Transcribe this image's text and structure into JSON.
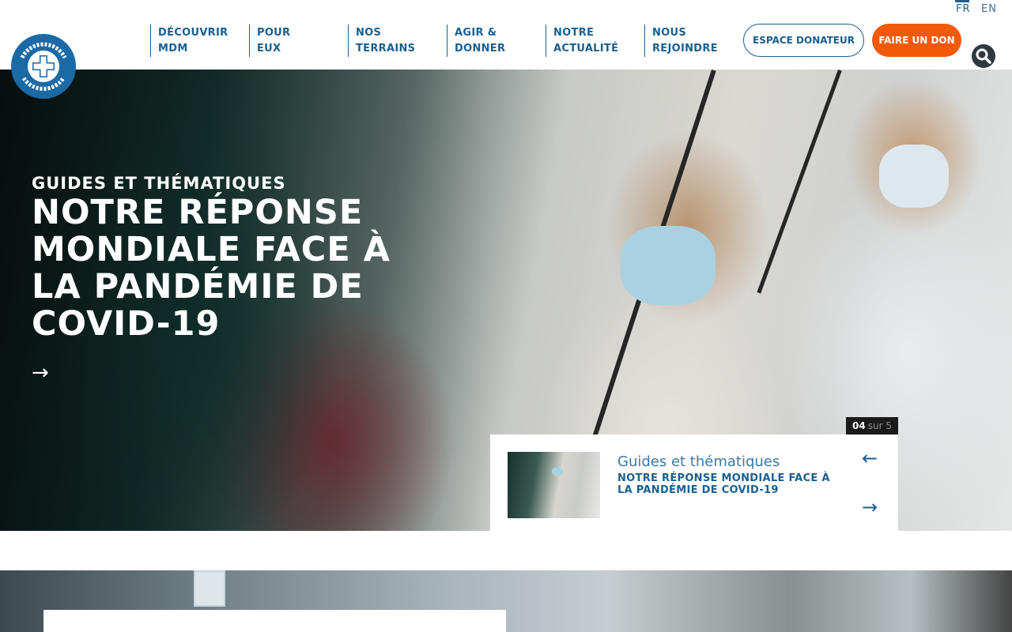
{
  "header": {
    "logo_alt": "MÉDECINS DU MONDE",
    "lang": {
      "fr": "FR",
      "en": "EN"
    },
    "nav": [
      {
        "line1": "DÉCOUVRIR",
        "line2": "MDM"
      },
      {
        "line1": "POUR",
        "line2": "EUX"
      },
      {
        "line1": "NOS",
        "line2": "TERRAINS"
      },
      {
        "line1": "AGIR &",
        "line2": "DONNER"
      },
      {
        "line1": "NOTRE",
        "line2": "ACTUALITÉ"
      },
      {
        "line1": "NOUS",
        "line2": "REJOINDRE"
      }
    ],
    "donor_label": "ESPACE DONATEUR",
    "donate_label": "FAIRE UN DON"
  },
  "hero": {
    "kicker": "GUIDES ET THÉMATIQUES",
    "title": "NOTRE RÉPONSE MONDIALE FACE À LA PANDÉMIE DE COVID-19",
    "arrow": "→"
  },
  "slider": {
    "current": "04",
    "total_text": "sur 5",
    "card_category": "Guides et thématiques",
    "card_title": "NOTRE RÉPONSE MONDIALE FACE À LA PANDÉMIE DE COVID-19",
    "prev": "←",
    "next": "→"
  },
  "colors": {
    "brand_blue": "#1a5f8f",
    "donate_orange": "#f25a0a",
    "logo_blue": "#1a6aa6"
  },
  "icons": [
    "medecins-du-monde-logo",
    "search-icon",
    "arrow-right-icon",
    "arrow-left-icon"
  ]
}
